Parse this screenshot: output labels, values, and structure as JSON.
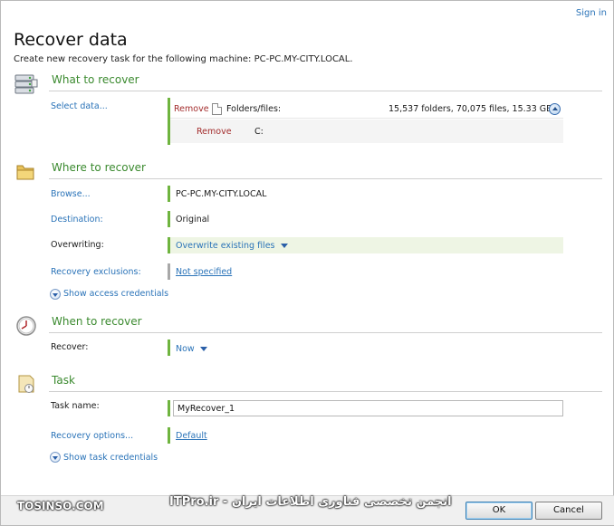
{
  "header": {
    "sign_in": "Sign in",
    "title": "Recover data",
    "subtitle": "Create new recovery task for the following machine: PC-PC.MY-CITY.LOCAL."
  },
  "what": {
    "title": "What to recover",
    "icon": "drives-icon",
    "select_link": "Select data...",
    "items": [
      {
        "remove": "Remove",
        "type_label": "Folders/files:",
        "summary": "15,537 folders, 70,075 files, 15.33 GB"
      },
      {
        "remove": "Remove",
        "path": "C:"
      }
    ]
  },
  "where": {
    "title": "Where to recover",
    "icon": "folder-icon",
    "browse_link": "Browse...",
    "machine": "PC-PC.MY-CITY.LOCAL",
    "destination_label": "Destination:",
    "destination_value": "Original",
    "overwriting_label": "Overwriting:",
    "overwriting_value": "Overwrite existing files",
    "exclusions_label": "Recovery exclusions:",
    "exclusions_value": "Not specified",
    "show_credentials": "Show access credentials"
  },
  "when": {
    "title": "When to recover",
    "icon": "clock-icon",
    "recover_label": "Recover:",
    "recover_value": "Now"
  },
  "task": {
    "title": "Task",
    "icon": "task-icon",
    "name_label": "Task name:",
    "name_value": "MyRecover_1",
    "options_label": "Recovery options...",
    "options_value": "Default",
    "show_credentials": "Show task credentials"
  },
  "footer": {
    "watermark_left": "TOSINSO.COM",
    "watermark_center": "ITPro.ir - انجمن تخصصی فناوری اطلاعات ایران",
    "ok": "OK",
    "cancel": "Cancel"
  },
  "colors": {
    "section_title": "#3b8a2f",
    "link": "#2a73b8",
    "accent_bar": "#6fb43f",
    "remove": "#a32d2d"
  }
}
